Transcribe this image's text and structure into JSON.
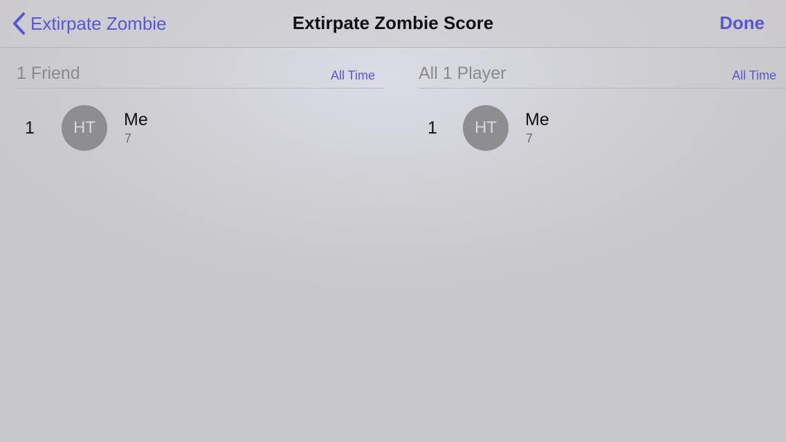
{
  "nav": {
    "back_label": "Extirpate Zombie",
    "title": "Extirpate Zombie Score",
    "done_label": "Done"
  },
  "colors": {
    "accent": "#5b55d6",
    "avatar": "#8e8e91"
  },
  "leaderboards": [
    {
      "header": "1 Friend",
      "time_filter": "All Time",
      "entries": [
        {
          "rank": "1",
          "initials": "HT",
          "name": "Me",
          "score": "7"
        }
      ]
    },
    {
      "header": "All 1 Player",
      "time_filter": "All Time",
      "entries": [
        {
          "rank": "1",
          "initials": "HT",
          "name": "Me",
          "score": "7"
        }
      ]
    }
  ]
}
